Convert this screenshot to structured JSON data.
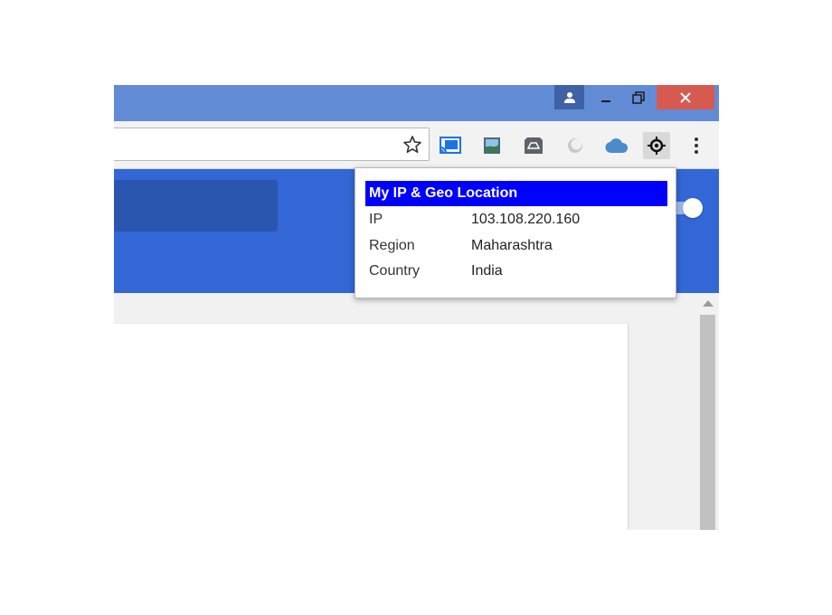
{
  "colors": {
    "titlebar": "#628bd6",
    "close_button": "#d75a50",
    "page_header": "#3367d6",
    "popup_title_bg": "#0000ff",
    "popup_title_text": "#ffffff"
  },
  "window_controls": {
    "profile_icon": "person-icon",
    "minimize_icon": "minimize-icon",
    "restore_icon": "restore-icon",
    "close_icon": "close-icon"
  },
  "toolbar": {
    "bookmark_icon": "star-icon",
    "extensions": [
      {
        "name": "cast-icon"
      },
      {
        "name": "image-icon"
      },
      {
        "name": "drive-icon"
      },
      {
        "name": "circle-icon"
      },
      {
        "name": "cloud-icon"
      },
      {
        "name": "geo-location-icon"
      }
    ],
    "menu_icon": "more-vertical-icon"
  },
  "popup": {
    "title": "My IP & Geo Location",
    "rows": [
      {
        "key": "IP",
        "value": "103.108.220.160"
      },
      {
        "key": "Region",
        "value": "Maharashtra"
      },
      {
        "key": "Country",
        "value": "India"
      }
    ]
  }
}
